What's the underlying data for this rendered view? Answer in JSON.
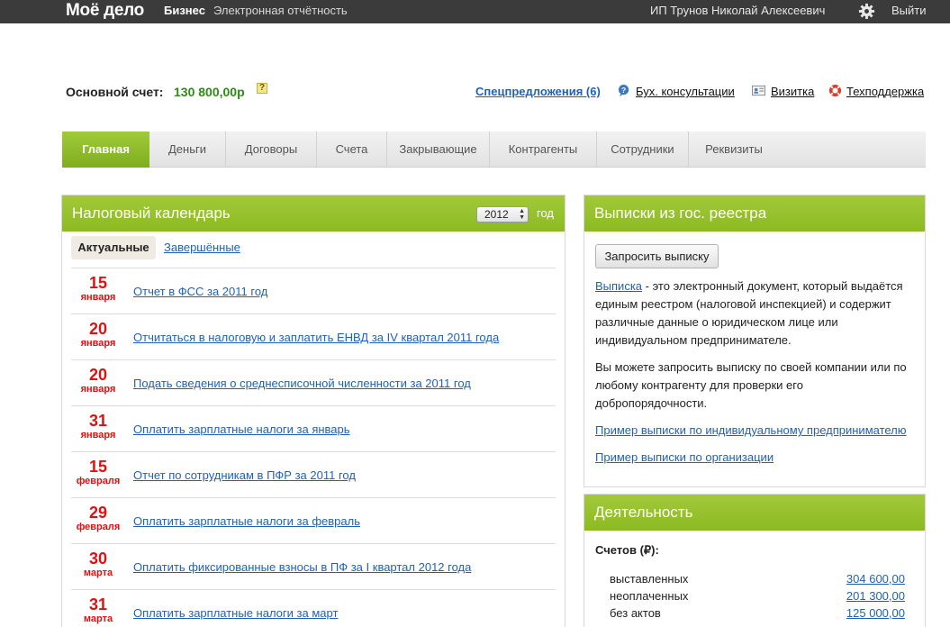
{
  "topbar": {
    "logo": "Моё дело",
    "business": "Бизнес",
    "e_reporting": "Электронная отчётность",
    "user_name": "ИП Трунов Николай Алексеевич",
    "exit": "Выйти"
  },
  "account": {
    "label": "Основной счет:",
    "value": "130 800,00р",
    "help": "?"
  },
  "header_links": {
    "special_offers": "Спецпредложения (6)",
    "consultations": "Бух. консультации",
    "business_card": "Визитка",
    "support": "Техподдержка"
  },
  "tabs": [
    "Главная",
    "Деньги",
    "Договоры",
    "Счета",
    "Закрывающие",
    "Контрагенты",
    "Сотрудники",
    "Реквизиты"
  ],
  "tax_calendar": {
    "title": "Налоговый календарь",
    "year": "2012",
    "year_suffix": "год",
    "filter_active": "Актуальные",
    "filter_done": "Завершённые",
    "items": [
      {
        "day": "15",
        "month": "января",
        "task": "Отчет в ФСС за 2011 год"
      },
      {
        "day": "20",
        "month": "января",
        "task": "Отчитаться в налоговую и заплатить ЕНВД за IV квартал 2011 года"
      },
      {
        "day": "20",
        "month": "января",
        "task": "Подать сведения о среднесписочной численности за 2011 год"
      },
      {
        "day": "31",
        "month": "января",
        "task": "Оплатить зарплатные налоги за январь"
      },
      {
        "day": "15",
        "month": "февраля",
        "task": "Отчет по сотрудникам в ПФР за 2011 год"
      },
      {
        "day": "29",
        "month": "февраля",
        "task": "Оплатить зарплатные налоги за февраль"
      },
      {
        "day": "30",
        "month": "марта",
        "task": "Оплатить фиксированные взносы в ПФ за I квартал 2012 года"
      },
      {
        "day": "31",
        "month": "марта",
        "task": "Оплатить зарплатные налоги за март"
      }
    ]
  },
  "registry": {
    "title": "Выписки из гос. реестра",
    "request_button": "Запросить выписку",
    "link_word": "Выписка",
    "desc1_line1": " - это электронный документ, который выдаётся",
    "desc1_line2": "единым реестром (налоговой инспекцией) и содержит",
    "desc1_line3": "различные данные о юридическом лице или",
    "desc1_line4": "индивидуальном предпринимателе.",
    "desc2_line1": "Вы можете запросить выписку по своей компании или по",
    "desc2_line2": "любому контрагенту для проверки его",
    "desc2_line3": "добропорядочности.",
    "example_ip": "Пример выписки по индивидуальному предпринимателю",
    "example_org": "Пример выписки по организации"
  },
  "activity": {
    "title": "Деятельность",
    "invoices_label": "Счетов (₽):",
    "rows": [
      {
        "label": "выставленных",
        "value": "304 600,00"
      },
      {
        "label": "неоплаченных",
        "value": "201 300,00"
      },
      {
        "label": "без актов",
        "value": "125 000,00"
      }
    ]
  },
  "colors": {
    "accent_green": "#8cba22",
    "date_red": "#e01010",
    "link_blue": "#1f62b5",
    "balance_green": "#2f8a16",
    "topbar": "#3b3b3b"
  }
}
